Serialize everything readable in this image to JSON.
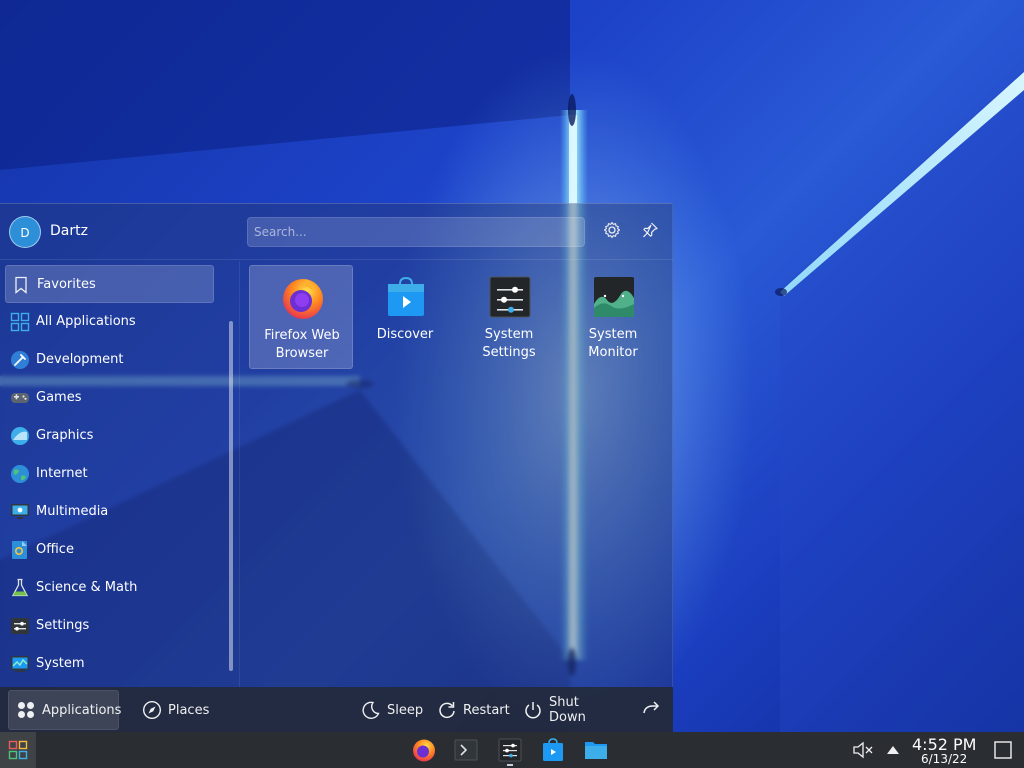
{
  "user": {
    "initial": "D",
    "name": "Dartz"
  },
  "search": {
    "placeholder": "Search..."
  },
  "header": {
    "config_icon": "gear-icon",
    "pin_icon": "pin-icon"
  },
  "categories": [
    {
      "label": "Favorites",
      "icon": "bookmark-icon",
      "selected": true
    },
    {
      "label": "All Applications",
      "icon": "grid-icon"
    },
    {
      "label": "Development",
      "icon": "development-icon"
    },
    {
      "label": "Games",
      "icon": "gamepad-icon"
    },
    {
      "label": "Graphics",
      "icon": "graphics-icon"
    },
    {
      "label": "Internet",
      "icon": "globe-icon"
    },
    {
      "label": "Multimedia",
      "icon": "monitor-icon"
    },
    {
      "label": "Office",
      "icon": "office-icon"
    },
    {
      "label": "Science & Math",
      "icon": "flask-icon"
    },
    {
      "label": "Settings",
      "icon": "settings-icon"
    },
    {
      "label": "System",
      "icon": "system-icon"
    }
  ],
  "favorites": [
    {
      "label": "Firefox Web Browser",
      "icon": "firefox-icon",
      "selected": true
    },
    {
      "label": "Discover",
      "icon": "discover-icon"
    },
    {
      "label": "System Settings",
      "icon": "system-settings-icon"
    },
    {
      "label": "System Monitor",
      "icon": "system-monitor-icon"
    }
  ],
  "footer": {
    "applications": "Applications",
    "places": "Places",
    "sleep": "Sleep",
    "restart": "Restart",
    "shutdown": "Shut Down"
  },
  "taskbar": {
    "items": [
      "firefox-icon",
      "terminal-icon",
      "system-settings-icon",
      "discover-icon",
      "folder-icon"
    ],
    "time": "4:52 PM",
    "date": "6/13/22"
  },
  "colors": {
    "accent": "#3daee9",
    "panel": "#2a2e32"
  }
}
